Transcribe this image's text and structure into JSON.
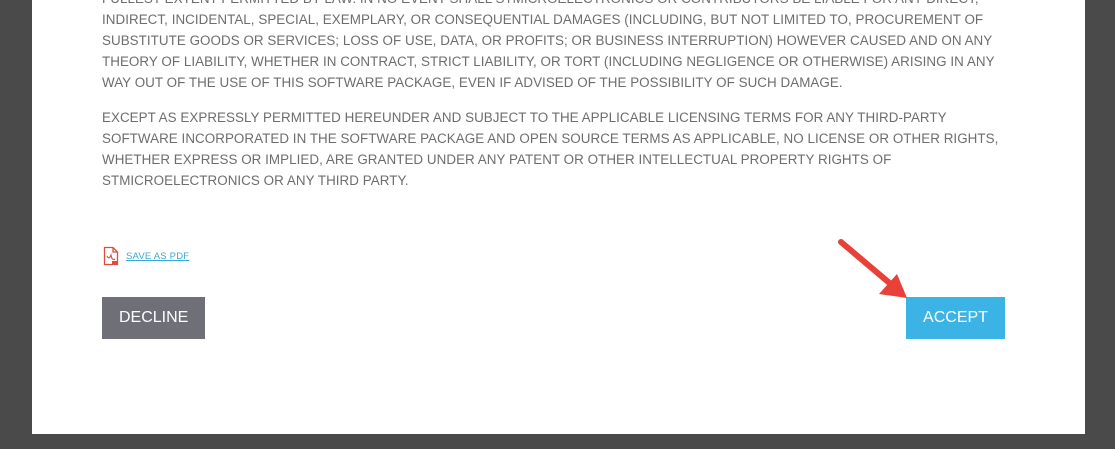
{
  "license": {
    "paragraph_1": "FULLEST EXTENT PERMITTED BY LAW. IN NO EVENT SHALL STMICROELECTRONICS OR CONTRIBUTORS BE LIABLE FOR ANY DIRECT, INDIRECT, INCIDENTAL, SPECIAL, EXEMPLARY, OR CONSEQUENTIAL DAMAGES (INCLUDING, BUT NOT LIMITED TO, PROCUREMENT OF SUBSTITUTE GOODS OR SERVICES; LOSS OF USE, DATA, OR PROFITS; OR BUSINESS INTERRUPTION) HOWEVER CAUSED AND ON ANY THEORY OF LIABILITY, WHETHER IN CONTRACT, STRICT LIABILITY, OR TORT (INCLUDING NEGLIGENCE OR OTHERWISE) ARISING IN ANY WAY OUT OF THE USE OF THIS SOFTWARE PACKAGE, EVEN IF ADVISED OF THE POSSIBILITY OF SUCH DAMAGE.",
    "paragraph_2": "EXCEPT AS EXPRESSLY PERMITTED HEREUNDER AND SUBJECT TO THE APPLICABLE LICENSING TERMS FOR ANY THIRD-PARTY SOFTWARE INCORPORATED IN THE SOFTWARE PACKAGE AND OPEN SOURCE TERMS AS APPLICABLE, NO LICENSE OR OTHER RIGHTS, WHETHER EXPRESS OR IMPLIED, ARE GRANTED UNDER ANY PATENT OR OTHER INTELLECTUAL PROPERTY RIGHTS OF STMICROELECTRONICS OR ANY THIRD PARTY."
  },
  "pdf": {
    "label": "SAVE AS PDF",
    "icon": "pdf-file-icon"
  },
  "buttons": {
    "decline_label": "DECLINE",
    "accept_label": "ACCEPT"
  },
  "annotation": {
    "icon": "red-arrow-icon",
    "color": "#e8413a"
  },
  "colors": {
    "background": "#4a4a4a",
    "dialog": "#ffffff",
    "text": "#6d6d6d",
    "link": "#39a9dc",
    "decline": "#6f6f77",
    "accept": "#3bb3e4"
  }
}
